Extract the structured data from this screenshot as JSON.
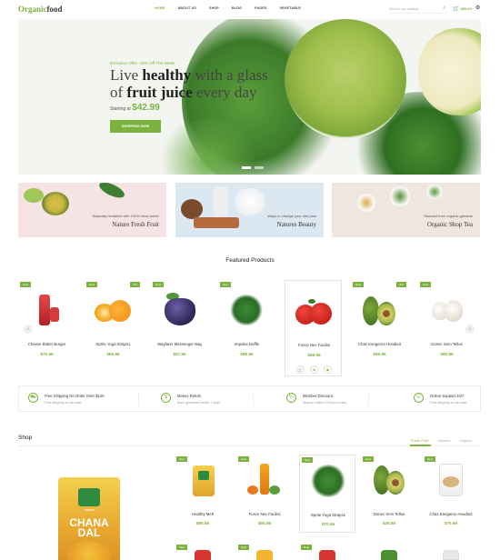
{
  "header": {
    "logo_part1": "Organic",
    "logo_part2": "food",
    "nav": [
      "Home",
      "About Us",
      "Shop",
      "Blog",
      "Pages",
      "Vegetable"
    ],
    "search_placeholder": "Search our catalog",
    "cart_total": "$65.00"
  },
  "hero": {
    "offer": "Exclusive Offer -10% Off This Week",
    "line1_pre": "Live ",
    "line1_bold": "healthy",
    "line1_post": " with a glass",
    "line2_pre": "of ",
    "line2_bold": "fruit juice",
    "line2_post": " every day",
    "starting_label": "Starting at ",
    "starting_price": "$42.99",
    "button": "Shopping Now"
  },
  "banners": [
    {
      "subtitle": "Naturally revitalize with 100% shea butter",
      "title": "Nature Fresh Fruit"
    },
    {
      "subtitle": "Ways to change your diet plan",
      "title": "Natures Beauty"
    },
    {
      "subtitle": "Sourced from organic gardens",
      "title": "Organic Shop Tea"
    }
  ],
  "featured": {
    "title": "Featured Products",
    "products": [
      {
        "name": "Cheese Butter Burger",
        "price": "$75.66",
        "badge": "New",
        "sale": ""
      },
      {
        "name": "Sprite Yoga Straps1",
        "price": "$65.66",
        "badge": "New",
        "sale": "-5%"
      },
      {
        "name": "Wayfarer Messenger Bag",
        "price": "$57.66",
        "badge": "New",
        "sale": ""
      },
      {
        "name": "Impulse Duffle",
        "price": "$95.66",
        "badge": "New",
        "sale": ""
      },
      {
        "name": "Fusce Nec Facilisi",
        "price": "$88.66",
        "badge": "",
        "sale": ""
      },
      {
        "name": "Chaz Kangeroo Hoodie3",
        "price": "$99.66",
        "badge": "New",
        "sale": "-5%"
      },
      {
        "name": "Donec Sem Tellus",
        "price": "$80.66",
        "badge": "New",
        "sale": ""
      }
    ]
  },
  "services": [
    {
      "title": "Free Shipping On Order Over $120",
      "sub": "Free shipping on all order"
    },
    {
      "title": "Money Return",
      "sub": "Back guarantee under 7 days"
    },
    {
      "title": "Member Discount",
      "sub": "Support online 24 hours a day"
    },
    {
      "title": "Online Support 24/7",
      "sub": "Free shipping on all order"
    }
  ],
  "shop": {
    "title": "Shop",
    "tabs": [
      "Fresh Fruit",
      "Flowers",
      "Organic"
    ],
    "featured_bag": {
      "brand": "ANGUR",
      "name_line1": "CHANA",
      "name_line2": "DAL"
    },
    "products": [
      {
        "name": "Healthy Melt",
        "price": "$90.66",
        "badge": "New"
      },
      {
        "name": "Fusce Nec Facilisi",
        "price": "$50.66",
        "badge": "New"
      },
      {
        "name": "Sprite Yoga Straps1",
        "price": "$70.66",
        "badge": "New"
      },
      {
        "name": "Donec Sem Tellus",
        "price": "$45.66",
        "badge": "New"
      },
      {
        "name": "Chaz Kangeroo Hoodie3",
        "price": "$75.66",
        "badge": "New"
      }
    ],
    "row2_badges": [
      "New",
      "New",
      "New"
    ]
  },
  "colors": {
    "accent": "#7cb33f"
  }
}
